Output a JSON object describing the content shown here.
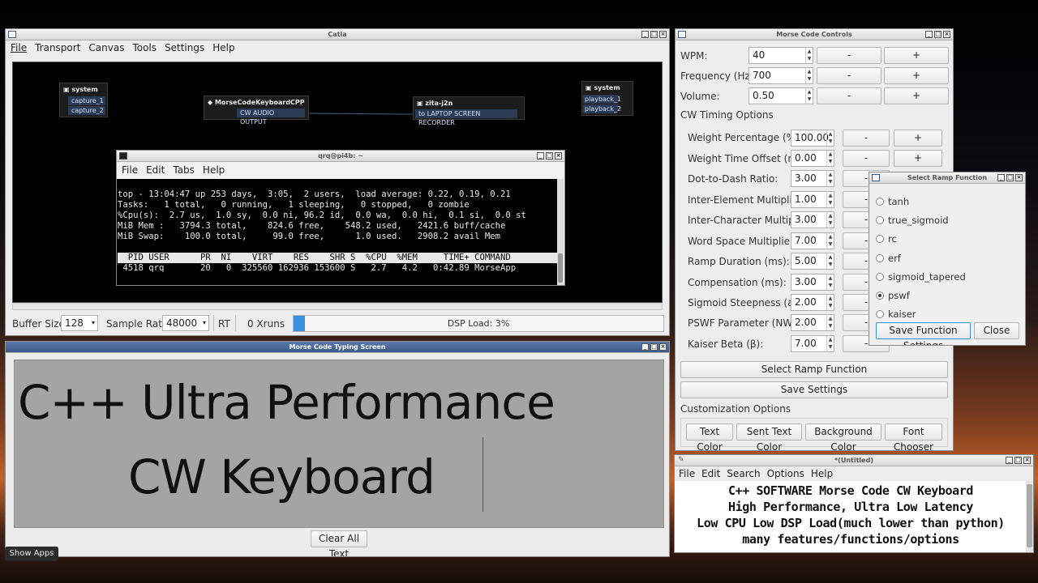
{
  "catia": {
    "title": "Catia",
    "menu": [
      "File",
      "Transport",
      "Canvas",
      "Tools",
      "Settings",
      "Help"
    ],
    "nodes": {
      "system_in": {
        "title": "system",
        "ports": [
          "capture_1",
          "capture_2"
        ]
      },
      "morse": {
        "title": "MorseCodeKeyboardCPP",
        "ports": [
          "CW AUDIO OUTPUT"
        ]
      },
      "zita": {
        "title": "zita-j2n",
        "ports": [
          "to LAPTOP SCREEN RECORDER"
        ]
      },
      "system_out": {
        "title": "system",
        "ports": [
          "playback_1",
          "playback_2"
        ]
      }
    },
    "bottom": {
      "buffer_label": "Buffer Size:",
      "buffer_value": "128",
      "rate_label": "Sample Rate:",
      "rate_value": "48000",
      "rt": "RT",
      "xruns": "0 Xruns",
      "dsp": "DSP Load: 3%",
      "dsp_percent": 3
    }
  },
  "terminal": {
    "title": "qrq@pi4b: ~",
    "menu": [
      "File",
      "Edit",
      "Tabs",
      "Help"
    ],
    "lines": [
      "top - 13:04:47 up 253 days,  3:05,  2 users,  load average: 0.22, 0.19, 0.21",
      "Tasks:   1 total,   0 running,   1 sleeping,   0 stopped,   0 zombie",
      "%Cpu(s):  2.7 us,  1.0 sy,  0.0 ni, 96.2 id,  0.0 wa,  0.0 hi,  0.1 si,  0.0 st",
      "MiB Mem :   3794.3 total,    824.6 free,    548.2 used,   2421.6 buff/cache",
      "MiB Swap:    100.0 total,     99.0 free,      1.0 used.   2908.2 avail Mem"
    ],
    "header": "  PID USER      PR  NI    VIRT    RES    SHR S  %CPU  %MEM     TIME+ COMMAND",
    "row": " 4518 qrq       20   0  325560 162936 153600 S   2.7   4.2   0:42.89 MorseApp"
  },
  "typing": {
    "title": "Morse Code Typing Screen",
    "line1": "C++ Ultra Performance",
    "line2": "CW Keyboard",
    "clear_label": "Clear All Text"
  },
  "controls": {
    "title": "Morse Code Controls",
    "top_rows": [
      {
        "label": "WPM:",
        "value": "40"
      },
      {
        "label": "Frequency (Hz):",
        "value": "700"
      },
      {
        "label": "Volume:",
        "value": "0.50"
      }
    ],
    "minus": "-",
    "plus": "+",
    "timing_heading": "CW Timing Options",
    "timing_rows": [
      {
        "label": "Weight Percentage (%):",
        "value": "100.00"
      },
      {
        "label": "Weight Time Offset (ms):",
        "value": "0.00"
      },
      {
        "label": "Dot-to-Dash Ratio:",
        "value": "3.00"
      },
      {
        "label": "Inter-Element Multiplier:",
        "value": "1.00"
      },
      {
        "label": "Inter-Character Multiplier:",
        "value": "3.00"
      },
      {
        "label": "Word Space Multiplier:",
        "value": "7.00"
      },
      {
        "label": "Ramp Duration (ms):",
        "value": "5.00"
      },
      {
        "label": "Compensation (ms):",
        "value": "3.00"
      },
      {
        "label": "Sigmoid Steepness (a):",
        "value": "2.00"
      },
      {
        "label": "PSWF Parameter (NW):",
        "value": "2.00"
      },
      {
        "label": "Kaiser Beta (β):",
        "value": "7.00"
      }
    ],
    "select_ramp": "Select Ramp Function",
    "save_settings": "Save Settings",
    "custom_heading": "Customization Options",
    "custom_buttons": [
      "Text Color",
      "Sent Text Color",
      "Background Color",
      "Font Chooser"
    ]
  },
  "ramp": {
    "title": "Select Ramp Function",
    "options": [
      "tanh",
      "true_sigmoid",
      "rc",
      "erf",
      "sigmoid_tapered",
      "pswf",
      "kaiser"
    ],
    "selected": "pswf",
    "save": "Save Function Settings",
    "close": "Close"
  },
  "editor": {
    "title": "*(Untitled)",
    "menu": [
      "File",
      "Edit",
      "Search",
      "Options",
      "Help"
    ],
    "lines": [
      "C++ SOFTWARE Morse Code CW Keyboard",
      "High Performance, Ultra Low Latency",
      "Low CPU Low DSP Load(much lower than python)",
      "many features/functions/options"
    ]
  },
  "taskbar": {
    "show_apps": "Show Apps"
  }
}
